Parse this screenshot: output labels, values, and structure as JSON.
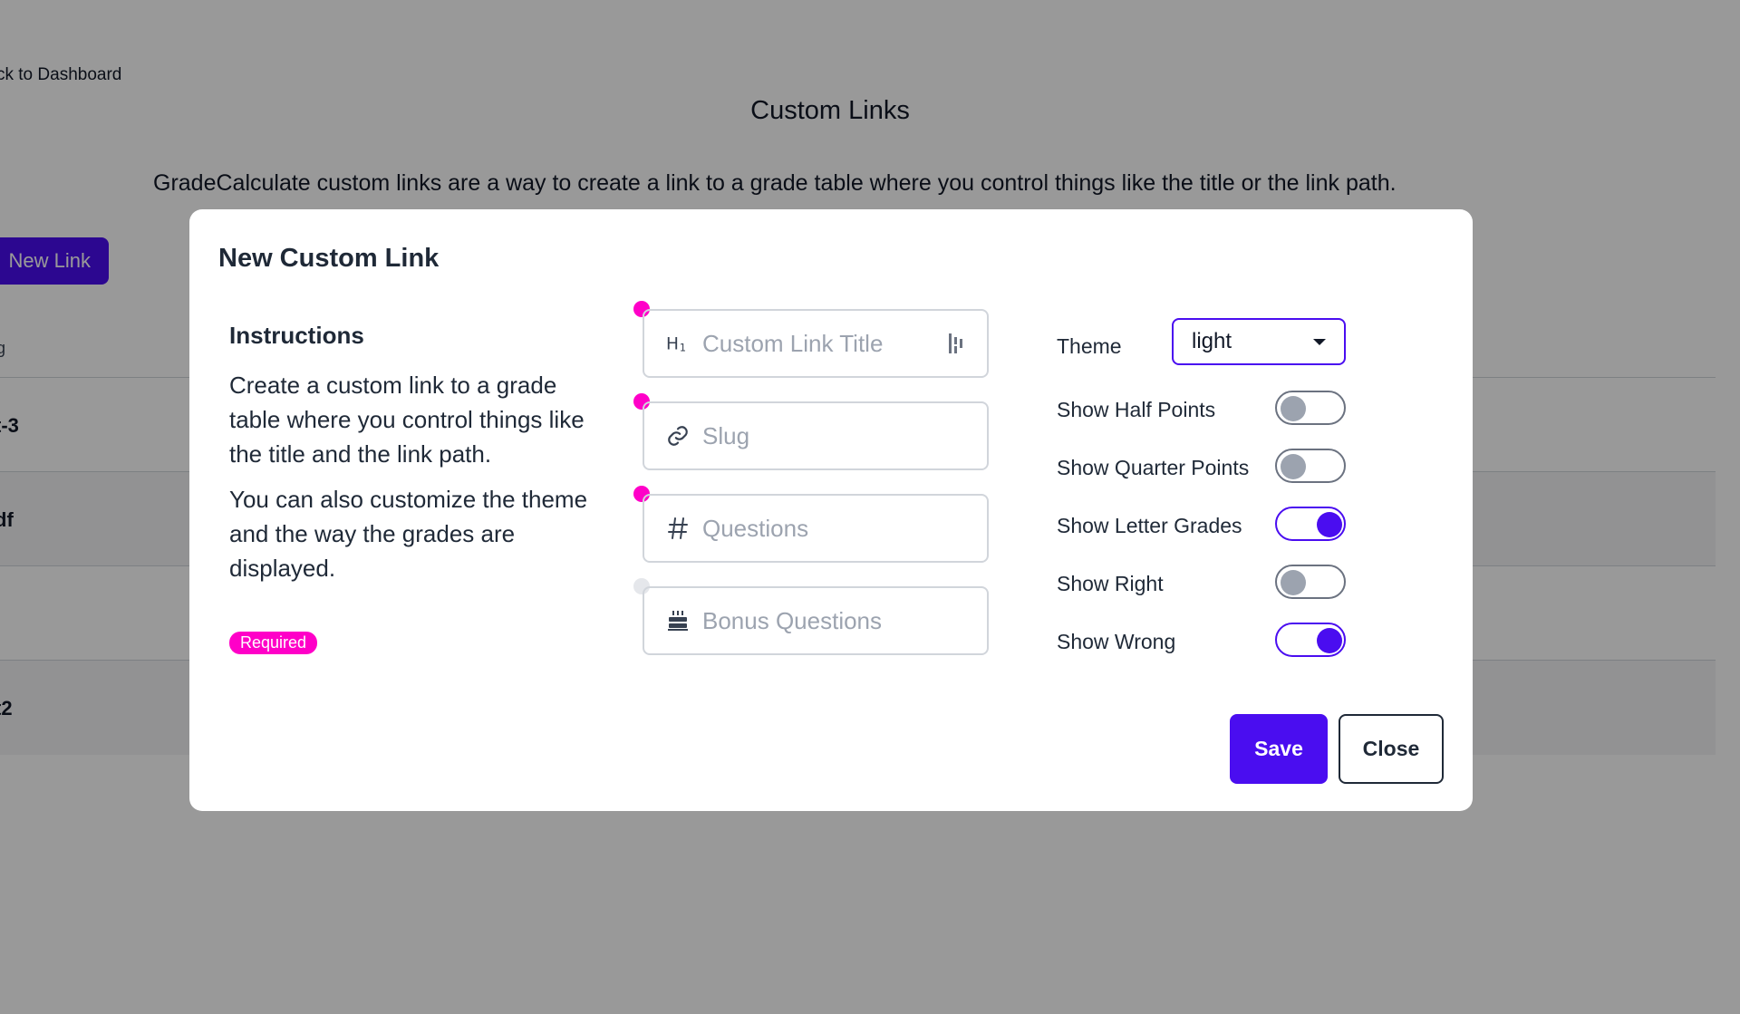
{
  "background": {
    "back_link": "ck to Dashboard",
    "page_title": "Custom Links",
    "description": "GradeCalculate custom links are a way to create a link to a grade table where you control things like the title or the link path.",
    "new_link_button": "New Link",
    "column_header": "g",
    "rows": [
      {
        "name": "t-3"
      },
      {
        "name": "df"
      },
      {
        "name": ""
      },
      {
        "name": "t2"
      }
    ]
  },
  "modal": {
    "title": "New Custom Link",
    "instructions": {
      "heading": "Instructions",
      "paragraph1": "Create a custom link to a grade table where you control things like the title and the link path.",
      "paragraph2": "You can also customize the theme and the way the grades are displayed.",
      "required_badge": "Required"
    },
    "fields": [
      {
        "icon": "heading-icon",
        "placeholder": "Custom Link Title",
        "required": true
      },
      {
        "icon": "link-icon",
        "placeholder": "Slug",
        "required": true
      },
      {
        "icon": "hash-icon",
        "placeholder": "Questions",
        "required": true
      },
      {
        "icon": "cake-icon",
        "placeholder": "Bonus Questions",
        "required": false
      }
    ],
    "theme": {
      "label": "Theme",
      "value": "light"
    },
    "toggles": [
      {
        "label": "Show Half Points",
        "on": false
      },
      {
        "label": "Show Quarter Points",
        "on": false
      },
      {
        "label": "Show Letter Grades",
        "on": true
      },
      {
        "label": "Show Right",
        "on": false
      },
      {
        "label": "Show Wrong",
        "on": true
      }
    ],
    "save_label": "Save",
    "close_label": "Close"
  },
  "colors": {
    "accent": "#4a0df0",
    "required": "#ff00c8"
  }
}
